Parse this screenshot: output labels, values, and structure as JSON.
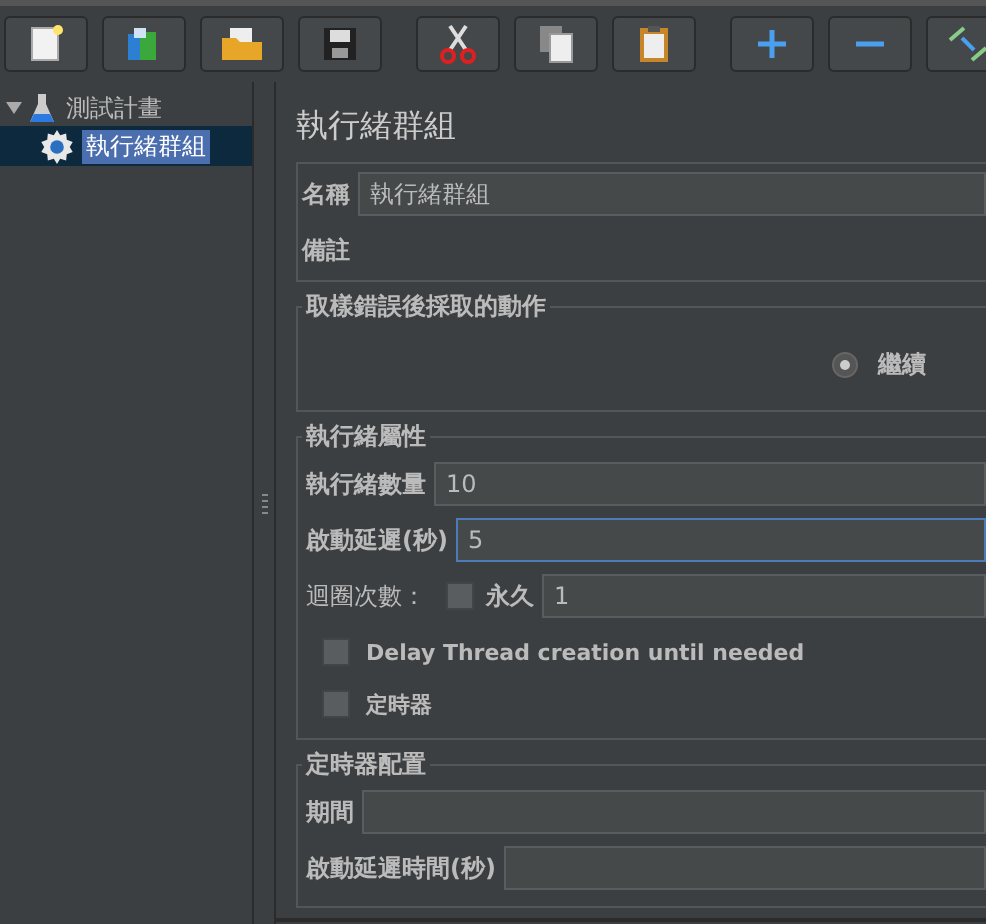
{
  "toolbar": [
    {
      "kind": "new"
    },
    {
      "kind": "templates"
    },
    {
      "kind": "open"
    },
    {
      "kind": "save"
    },
    {
      "kind": "cut"
    },
    {
      "kind": "copy"
    },
    {
      "kind": "paste"
    },
    {
      "kind": "add"
    },
    {
      "kind": "remove"
    },
    {
      "kind": "wand"
    }
  ],
  "tree": [
    {
      "label": "測試計畫",
      "kind": "plan",
      "expanded": true,
      "selected": false,
      "children": [
        {
          "label": "執行緒群組",
          "kind": "group",
          "selected": true
        }
      ]
    }
  ],
  "panel": {
    "title": "執行緒群組",
    "name": {
      "label": "名稱",
      "value": "執行緒群組"
    },
    "comment": {
      "label": "備註"
    },
    "error_action": {
      "title": "取樣錯誤後採取的動作",
      "options": [
        {
          "label": "繼續",
          "selected": true
        }
      ]
    },
    "thread_props": {
      "title": "執行緒屬性",
      "fields": [
        {
          "label": "執行緒數量",
          "value": "10",
          "focused": false
        },
        {
          "label": "啟動延遲(秒)",
          "value": "5",
          "focused": true
        }
      ],
      "loop": {
        "label": "迴圈次數：",
        "forever_label": "永久",
        "forever": false,
        "value": "1"
      },
      "checks": [
        {
          "label": "Delay Thread creation until needed",
          "checked": false
        },
        {
          "label": "定時器",
          "checked": false
        }
      ]
    },
    "scheduler": {
      "title": "定時器配置",
      "fields": [
        {
          "label": "期間"
        },
        {
          "label": "啟動延遲時間(秒)"
        }
      ]
    }
  }
}
